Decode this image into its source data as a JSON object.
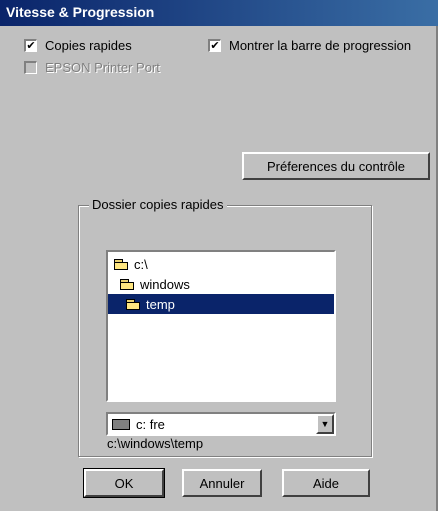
{
  "window": {
    "title": "Vitesse & Progression"
  },
  "options": {
    "fast_copies": {
      "label": "Copies rapides",
      "checked": true
    },
    "show_progress": {
      "label": "Montrer la barre de progression",
      "checked": true
    },
    "epson_port": {
      "label": "EPSON Printer Port",
      "checked": false,
      "disabled": true
    }
  },
  "monitor_prefs_label": "Préferences du contrôle",
  "folder_group": {
    "title": "Dossier copies rapides",
    "current_path": "c:\\windows\\temp",
    "tree": [
      "c:\\",
      "windows",
      "temp"
    ],
    "selected": "temp",
    "drive": "c:  fre"
  },
  "buttons": {
    "ok": "OK",
    "cancel": "Annuler",
    "help": "Aide"
  },
  "icons": {
    "checkmark": "✔",
    "dropdown": "▼"
  }
}
